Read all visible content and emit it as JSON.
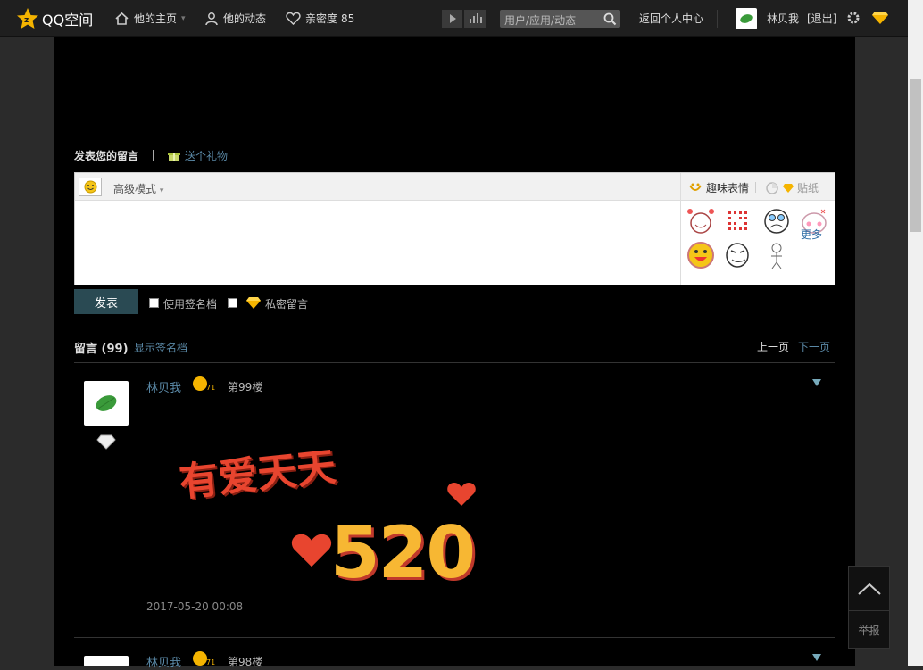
{
  "topbar": {
    "logo_text": "QQ空间",
    "home": "他的主页",
    "feeds": "他的动态",
    "intimacy_label": "亲密度",
    "intimacy_value": "85",
    "search_placeholder": "用户/应用/动态",
    "back_center": "返回个人中心",
    "username": "林贝我",
    "logout": "[退出]"
  },
  "post": {
    "title": "发表您的留言",
    "gift": "送个礼物",
    "advanced_mode": "高级模式",
    "fun_emoji": "趣味表情",
    "sticker": "贴纸",
    "more": "更多",
    "submit": "发表",
    "use_signature": "使用签名档",
    "private_msg": "私密留言"
  },
  "list": {
    "title": "留言",
    "count": "(99)",
    "show_signature": "显示签名档",
    "prev": "上一页",
    "next": "下一页"
  },
  "messages": [
    {
      "author": "林贝我",
      "floor": "第99楼",
      "time": "2017-05-20 00:08",
      "image_text": "有爱天天",
      "image_number": "520"
    },
    {
      "author": "林贝我",
      "floor": "第98楼"
    }
  ],
  "fab": {
    "report": "举报"
  },
  "colors": {
    "accent_link": "#5b8aa8",
    "submit_bg": "#2a4a53",
    "vip_gold": "#f5b400"
  }
}
